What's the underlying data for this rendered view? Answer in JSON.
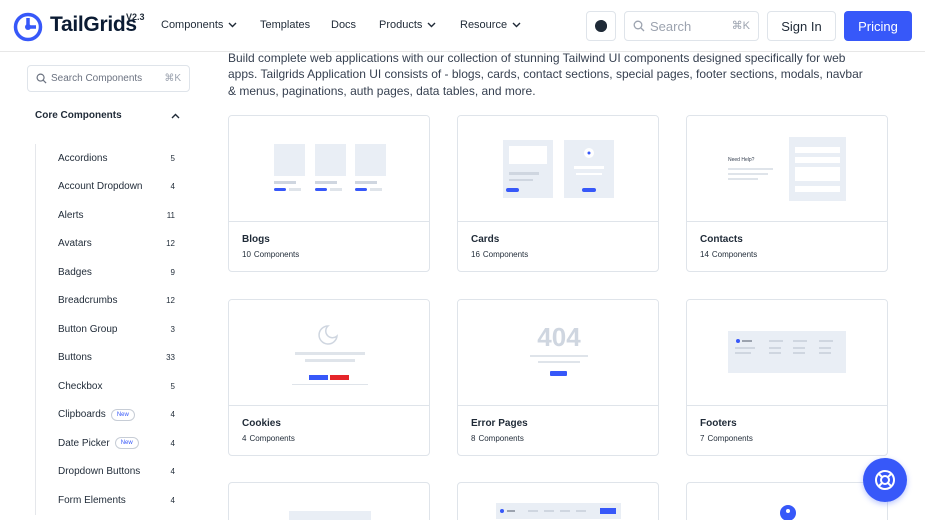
{
  "header": {
    "brand": "TailGrids",
    "version": "V2.3",
    "nav": [
      {
        "label": "Components",
        "dropdown": true
      },
      {
        "label": "Templates",
        "dropdown": false
      },
      {
        "label": "Docs",
        "dropdown": false
      },
      {
        "label": "Products",
        "dropdown": true
      },
      {
        "label": "Resource",
        "dropdown": true
      }
    ],
    "search_placeholder": "Search",
    "search_shortcut": "⌘K",
    "signin_label": "Sign In",
    "pricing_label": "Pricing",
    "accent_color": "#3758F9"
  },
  "sidebar": {
    "search_placeholder": "Search Components",
    "search_shortcut": "⌘K",
    "section_title": "Core Components",
    "items": [
      {
        "label": "Accordions",
        "count": "5",
        "new": false
      },
      {
        "label": "Account Dropdown",
        "count": "4",
        "new": false
      },
      {
        "label": "Alerts",
        "count": "11",
        "new": false
      },
      {
        "label": "Avatars",
        "count": "12",
        "new": false
      },
      {
        "label": "Badges",
        "count": "9",
        "new": false
      },
      {
        "label": "Breadcrumbs",
        "count": "12",
        "new": false
      },
      {
        "label": "Button Group",
        "count": "3",
        "new": false
      },
      {
        "label": "Buttons",
        "count": "33",
        "new": false
      },
      {
        "label": "Checkbox",
        "count": "5",
        "new": false
      },
      {
        "label": "Clipboards",
        "count": "4",
        "new": true
      },
      {
        "label": "Date Picker",
        "count": "4",
        "new": true
      },
      {
        "label": "Dropdown Buttons",
        "count": "4",
        "new": false
      },
      {
        "label": "Form Elements",
        "count": "4",
        "new": false
      }
    ],
    "new_badge_label": "New"
  },
  "main": {
    "intro": "Build complete web applications with our collection of stunning Tailwind UI components designed specifically for web apps. Tailgrids Application UI consists of - blogs, cards, contact sections, special pages, footer sections, modals, navbar & menus, paginations, auth pages, data tables, and more.",
    "cards": [
      {
        "title": "Blogs",
        "count": "10",
        "unit": "Components",
        "icon": "blogs-preview"
      },
      {
        "title": "Cards",
        "count": "16",
        "unit": "Components",
        "icon": "cards-preview"
      },
      {
        "title": "Contacts",
        "count": "14",
        "unit": "Components",
        "icon": "contacts-preview",
        "preview_text": "Need Help?"
      },
      {
        "title": "Cookies",
        "count": "4",
        "unit": "Components",
        "icon": "cookies-preview"
      },
      {
        "title": "Error Pages",
        "count": "8",
        "unit": "Components",
        "icon": "error-preview",
        "preview_text": "404"
      },
      {
        "title": "Footers",
        "count": "7",
        "unit": "Components",
        "icon": "footers-preview"
      }
    ]
  }
}
